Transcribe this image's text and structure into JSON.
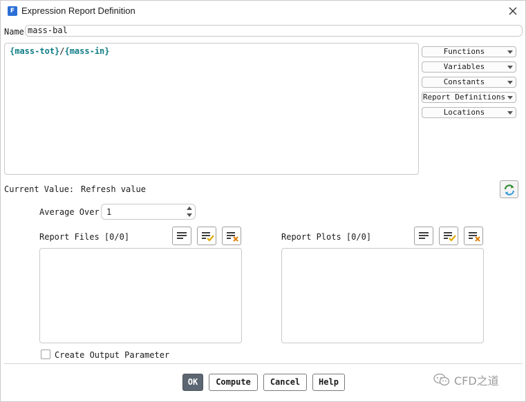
{
  "window": {
    "title": "Expression Report Definition"
  },
  "name_field": {
    "label": "Name",
    "value": "mass-bal"
  },
  "expression": {
    "token1": "{mass-tot}",
    "operator": "/",
    "token2": "{mass-in}"
  },
  "dropdowns": {
    "functions": "Functions",
    "variables": "Variables",
    "constants": "Constants",
    "report_definitions": "Report Definitions",
    "locations": "Locations"
  },
  "current_value": {
    "label": "Current Value:",
    "value": "Refresh value"
  },
  "average_over": {
    "label": "Average Over",
    "value": "1"
  },
  "report_files": {
    "label": "Report Files [0/0]"
  },
  "report_plots": {
    "label": "Report Plots [0/0]"
  },
  "create_output_parameter": {
    "label": "Create Output Parameter",
    "checked": false
  },
  "buttons": {
    "ok": "OK",
    "compute": "Compute",
    "cancel": "Cancel",
    "help": "Help"
  },
  "watermark": {
    "text": "CFD之道"
  },
  "colors": {
    "accent": "#2a6fd6",
    "expression_token": "#0f7d86",
    "primary_button": "#5c6672",
    "check_yellow": "#e0a800",
    "delete_orange": "#e07b00"
  }
}
